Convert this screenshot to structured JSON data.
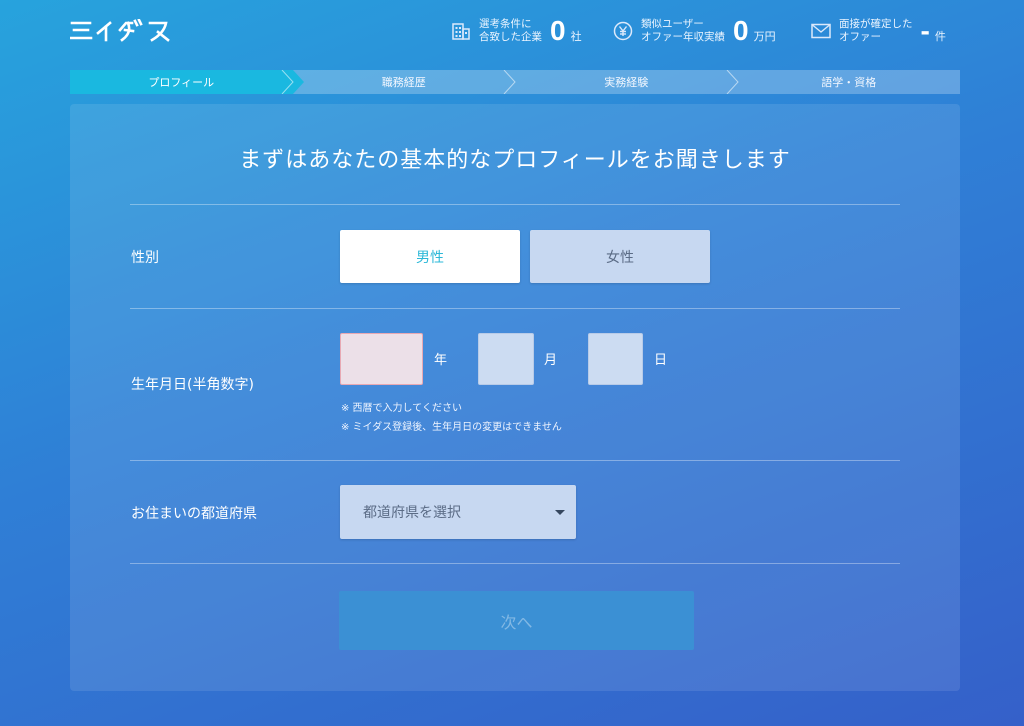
{
  "header": {
    "logo": "ミイダス",
    "stats": [
      {
        "label_line1": "選考条件に",
        "label_line2": "合致した企業",
        "value": "0",
        "unit": "社",
        "icon": "building-icon"
      },
      {
        "label_line1": "類似ユーザー",
        "label_line2": "オファー年収実績",
        "value": "0",
        "unit": "万円",
        "icon": "yen-icon"
      },
      {
        "label_line1": "面接が確定した",
        "label_line2": "オファー",
        "value": "-",
        "unit": "件",
        "icon": "mail-icon"
      }
    ]
  },
  "steps": [
    {
      "label": "プロフィール",
      "active": true
    },
    {
      "label": "職務経歴",
      "active": false
    },
    {
      "label": "実務経験",
      "active": false
    },
    {
      "label": "語学・資格",
      "active": false
    }
  ],
  "form": {
    "title": "まずはあなたの基本的なプロフィールをお聞きします",
    "gender": {
      "label": "性別",
      "male": "男性",
      "female": "女性",
      "selected": "男性"
    },
    "birthdate": {
      "label": "生年月日(半角数字)",
      "year_unit": "年",
      "month_unit": "月",
      "day_unit": "日",
      "year_value": "",
      "month_value": "",
      "day_value": "",
      "note1": "※ 西暦で入力してください",
      "note2": "※ ミイダス登録後、生年月日の変更はできません"
    },
    "prefecture": {
      "label": "お住まいの都道府県",
      "placeholder": "都道府県を選択"
    },
    "next_label": "次へ"
  },
  "colors": {
    "active_step": "#1ab8e0",
    "male_text": "#2cb8d8",
    "year_border": "#e8a9b3"
  }
}
